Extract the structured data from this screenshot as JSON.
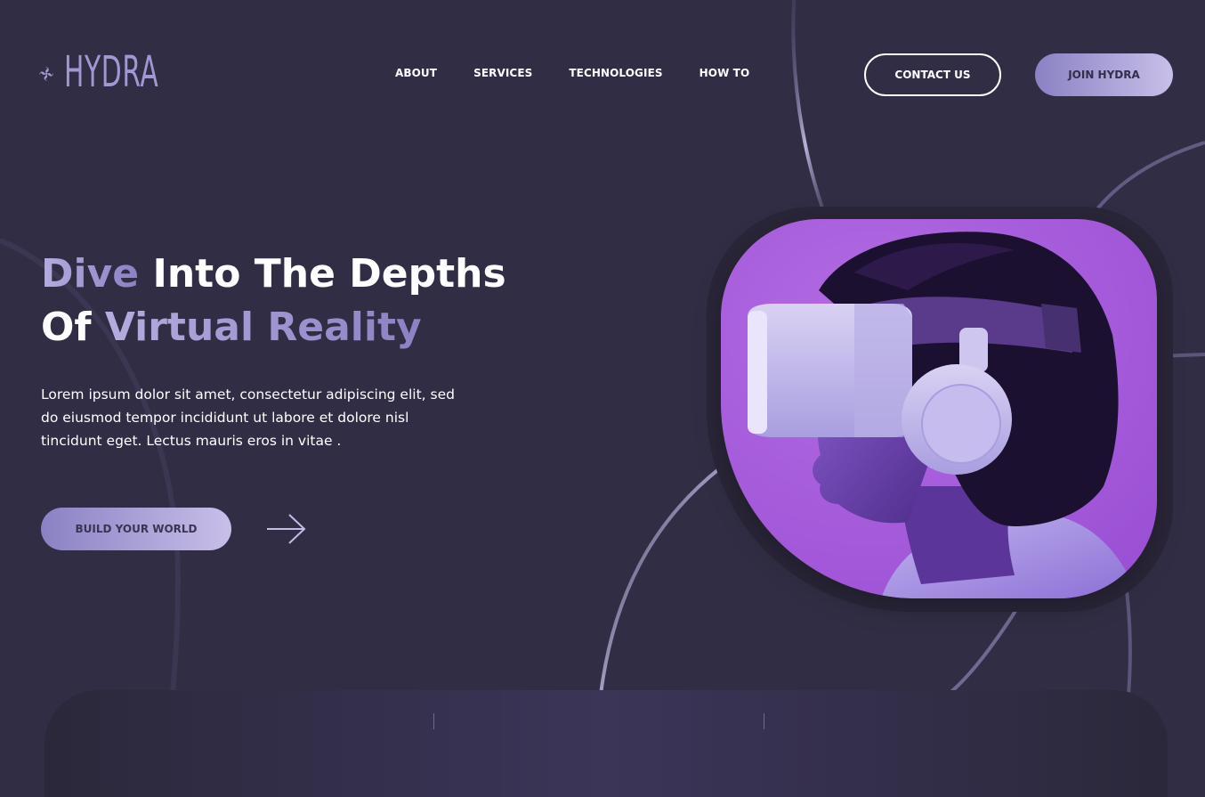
{
  "brand": {
    "name": "HYDRA",
    "logo_icon": "hydra-swirl-icon",
    "accent_color": "#9f98d3"
  },
  "nav": {
    "items": [
      {
        "label": "ABOUT"
      },
      {
        "label": "SERVICES"
      },
      {
        "label": "TECHNOLOGIES"
      },
      {
        "label": "HOW TO"
      }
    ]
  },
  "header": {
    "contact_label": "CONTACT US",
    "join_label": "JOIN HYDRA"
  },
  "hero": {
    "title_part1": "Dive",
    "title_part2": " Into The Depths",
    "title_part3": "Of ",
    "title_part4": "Virtual Reality",
    "description": "Lorem ipsum dolor sit amet, consectetur adipiscing elit, sed do eiusmod tempor incididunt ut labore et dolore nisl tincidunt eget. Lectus mauris eros in vitae .",
    "cta_label": "BUILD YOUR WORLD",
    "cta_arrow_icon": "arrow-right-icon",
    "image_subject": "vr-headset-portrait-image"
  },
  "colors": {
    "background": "#312d44",
    "button_gradient_start": "#8a81c4",
    "button_gradient_end": "#c8bfe9",
    "image_tint": "#a85ddc"
  }
}
